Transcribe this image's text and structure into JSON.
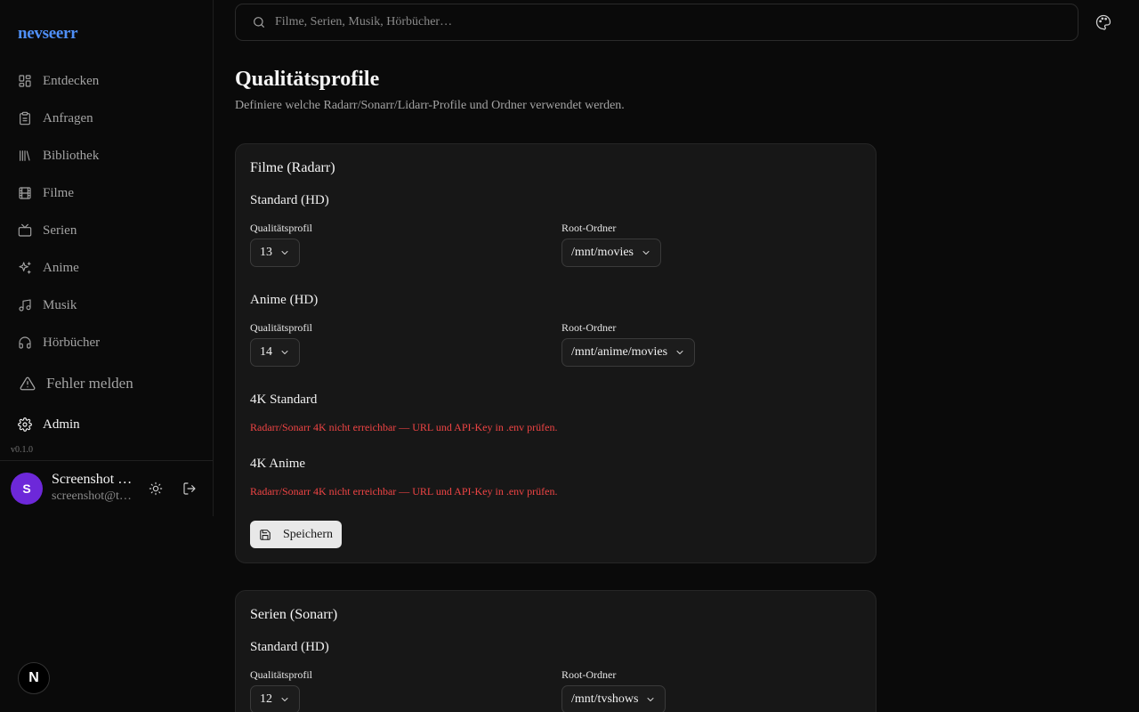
{
  "brand": "nevseerr",
  "sidebar": {
    "items": [
      {
        "label": "Entdecken",
        "icon": "grid-icon"
      },
      {
        "label": "Anfragen",
        "icon": "clipboard-icon"
      },
      {
        "label": "Bibliothek",
        "icon": "library-icon"
      },
      {
        "label": "Filme",
        "icon": "film-icon"
      },
      {
        "label": "Serien",
        "icon": "tv-icon"
      },
      {
        "label": "Anime",
        "icon": "sparkles-icon"
      },
      {
        "label": "Musik",
        "icon": "music-icon"
      },
      {
        "label": "Hörbücher",
        "icon": "headphones-icon"
      }
    ],
    "report_label": "Fehler melden",
    "admin_label": "Admin",
    "version": "v0.1.0"
  },
  "user": {
    "initial": "S",
    "name": "Screenshot …",
    "email": "screenshot@t…"
  },
  "search": {
    "placeholder": "Filme, Serien, Musik, Hörbücher…"
  },
  "page": {
    "title": "Qualitätsprofile",
    "subtitle": "Definiere welche Radarr/Sonarr/Lidarr-Profile und Ordner verwendet werden."
  },
  "movies_card": {
    "title": "Filme (Radarr)",
    "standard": {
      "title": "Standard (HD)",
      "profile_label": "Qualitätsprofil",
      "profile_value": "13",
      "root_label": "Root-Ordner",
      "root_value": "/mnt/movies"
    },
    "anime": {
      "title": "Anime (HD)",
      "profile_label": "Qualitätsprofil",
      "profile_value": "14",
      "root_label": "Root-Ordner",
      "root_value": "/mnt/anime/movies"
    },
    "k4_standard": {
      "title": "4K Standard",
      "error": "Radarr/Sonarr 4K nicht erreichbar — URL und API-Key in .env prüfen."
    },
    "k4_anime": {
      "title": "4K Anime",
      "error": "Radarr/Sonarr 4K nicht erreichbar — URL und API-Key in .env prüfen."
    },
    "save_label": "Speichern"
  },
  "series_card": {
    "title": "Serien (Sonarr)",
    "standard": {
      "title": "Standard (HD)",
      "profile_label": "Qualitätsprofil",
      "profile_value": "12",
      "root_label": "Root-Ordner",
      "root_value": "/mnt/tvshows"
    }
  },
  "next_badge": "N",
  "colors": {
    "accent": "#4f8ff7",
    "avatar": "#6d28d9",
    "error": "#ef4444"
  }
}
